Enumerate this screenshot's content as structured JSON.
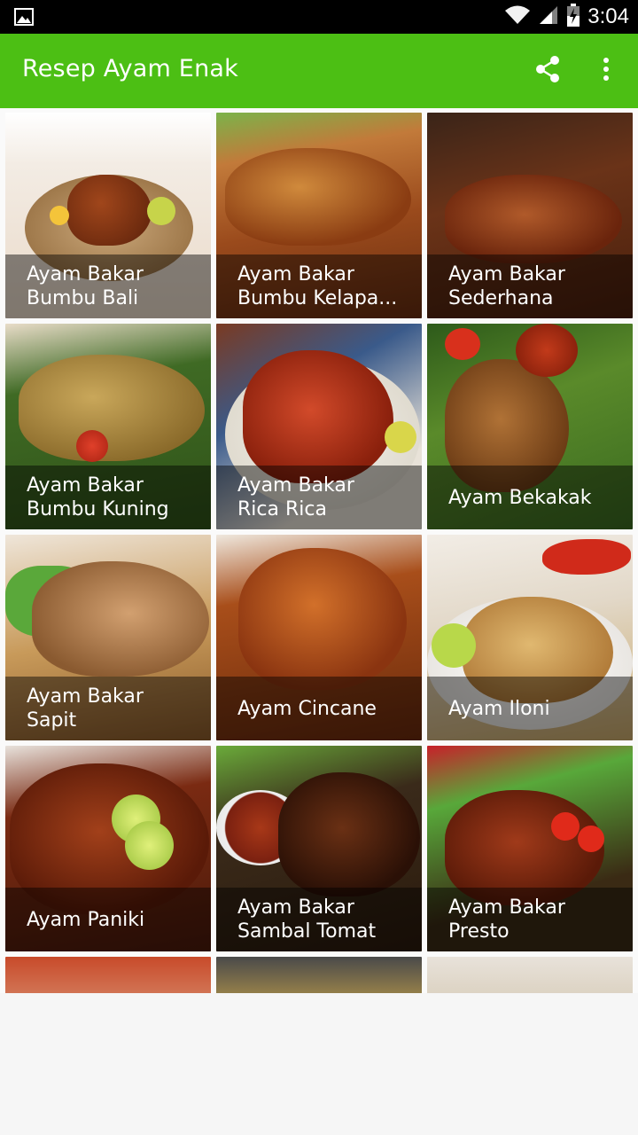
{
  "status_bar": {
    "time": "3:04",
    "icons": [
      "gallery-icon",
      "wifi-icon",
      "signal-icon",
      "battery-charging-icon"
    ]
  },
  "app_bar": {
    "title": "Resep Ayam Enak",
    "actions": [
      "share-icon",
      "more-vert-icon"
    ]
  },
  "colors": {
    "app_bar": "#4cbf14",
    "status_bar": "#000000",
    "caption_overlay": "rgba(0,0,0,0.45)"
  },
  "recipes": [
    {
      "title": "",
      "partial": true
    },
    {
      "title": "",
      "partial": true
    },
    {
      "title": "",
      "partial": true
    },
    {
      "title": "Ayam Bakar Bumbu Bali"
    },
    {
      "title": "Ayam Bakar Bumbu Kelapa..."
    },
    {
      "title": "Ayam Bakar Sederhana"
    },
    {
      "title": "Ayam Bakar Bumbu Kuning"
    },
    {
      "title": "Ayam Bakar Rica Rica"
    },
    {
      "title": "Ayam Bekakak"
    },
    {
      "title": "Ayam Bakar Sapit"
    },
    {
      "title": "Ayam Cincane"
    },
    {
      "title": "Ayam Iloni"
    },
    {
      "title": "Ayam Paniki"
    },
    {
      "title": "Ayam Bakar Sambal Tomat"
    },
    {
      "title": "Ayam Bakar Presto"
    },
    {
      "title": "",
      "partial": true
    },
    {
      "title": "",
      "partial": true
    },
    {
      "title": "",
      "partial": true
    }
  ]
}
